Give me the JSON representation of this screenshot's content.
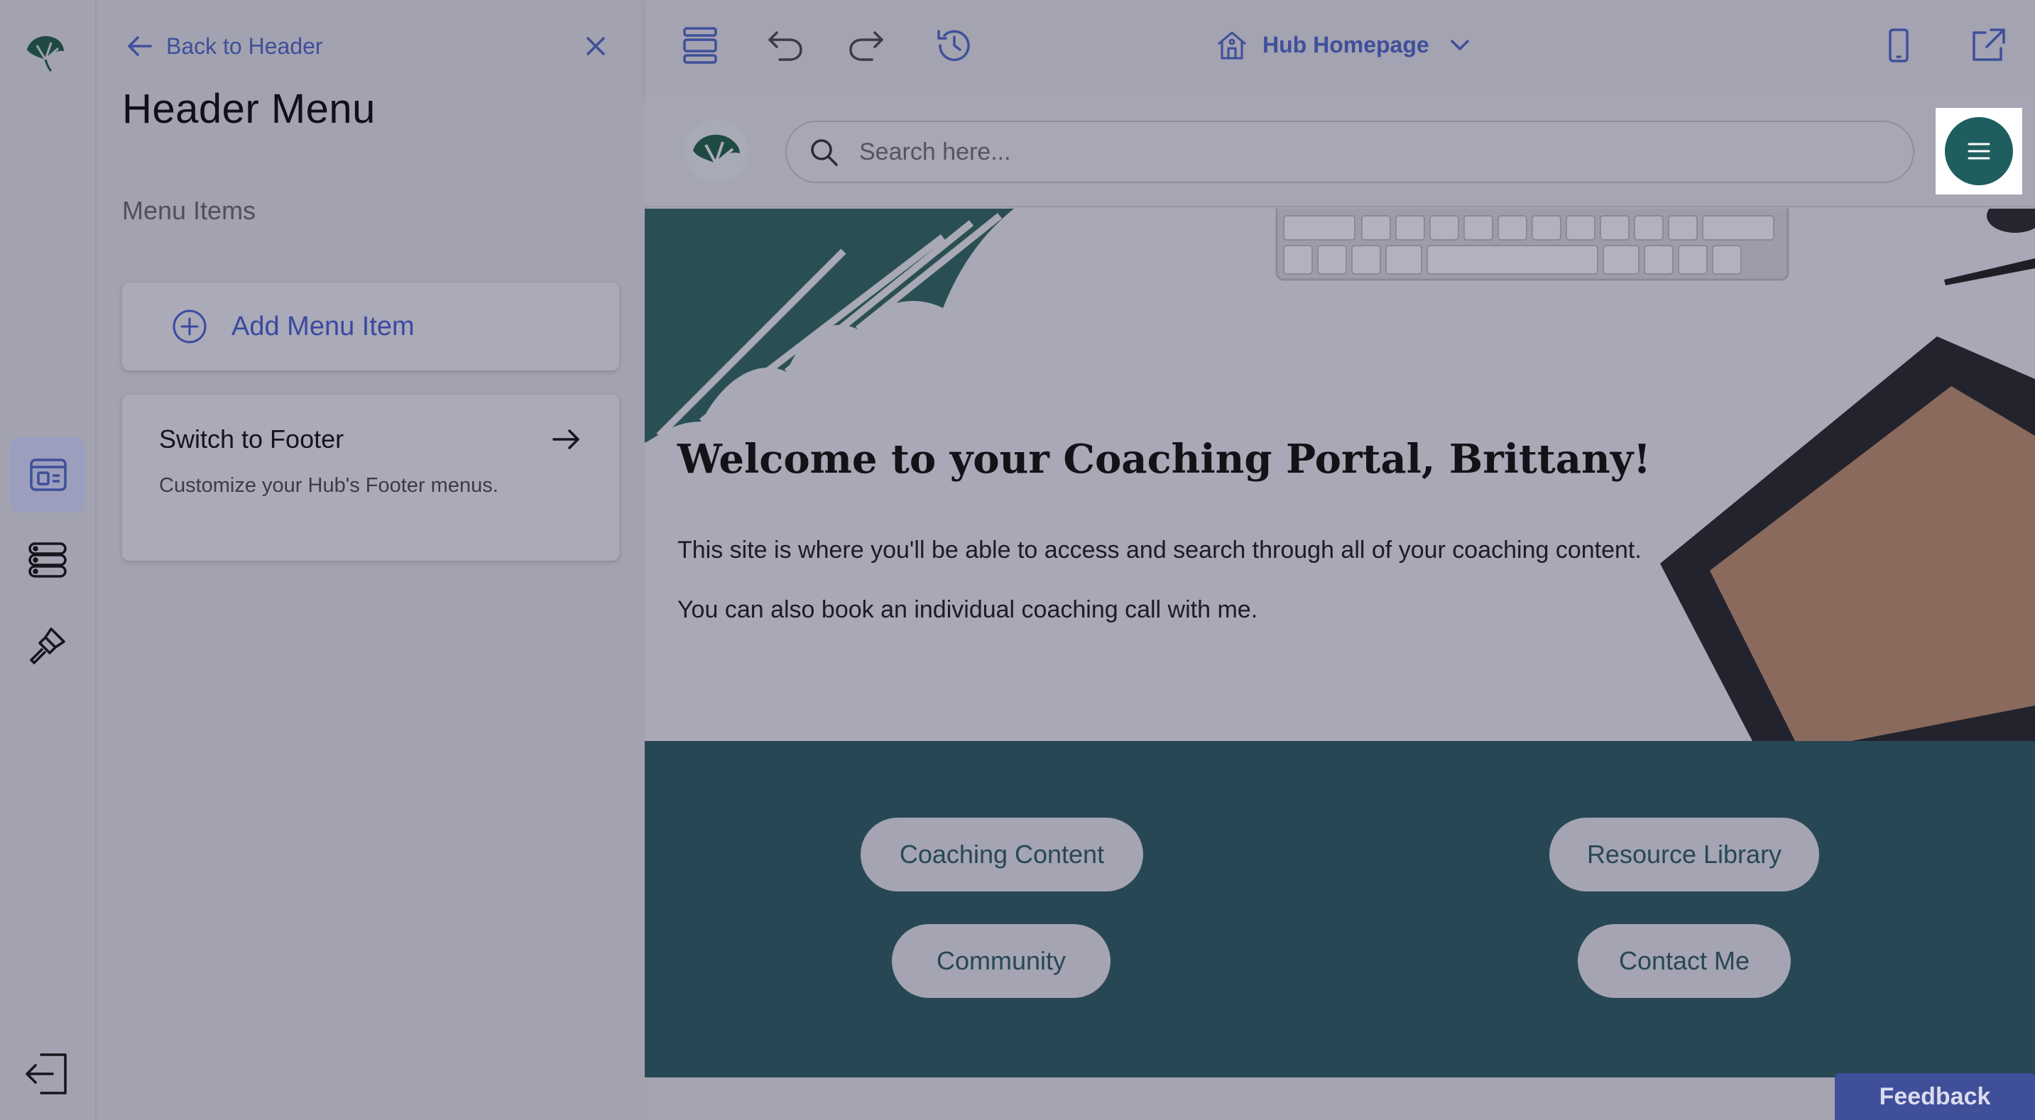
{
  "rail": {
    "items": [
      {
        "name": "sections",
        "icon": "layout-icon",
        "active": true
      },
      {
        "name": "menus",
        "icon": "list-icon",
        "active": false
      },
      {
        "name": "styles",
        "icon": "brush-icon",
        "active": false
      }
    ],
    "exit_icon": "exit-icon"
  },
  "panel": {
    "back_label": "Back to Header",
    "title": "Header Menu",
    "section_label": "Menu Items",
    "add_item_label": "Add Menu Item",
    "switch_title": "Switch to Footer",
    "switch_desc": "Customize your Hub's Footer menus."
  },
  "toolbar": {
    "page_name": "Hub Homepage"
  },
  "site": {
    "search_placeholder": "Search here...",
    "hero_title": "Welcome to your Coaching Portal, Brittany!",
    "hero_p1": "This site is where you'll be able to access and search through all of your coaching content.",
    "hero_p2": "You can also book an individual coaching call with me.",
    "links": [
      "Coaching Content",
      "Resource Library",
      "Community",
      "Contact Me"
    ]
  },
  "feedback_label": "Feedback",
  "colors": {
    "accent": "#3f4f9a",
    "brand_teal": "#1f5e5e",
    "links_bg": "#284755"
  }
}
